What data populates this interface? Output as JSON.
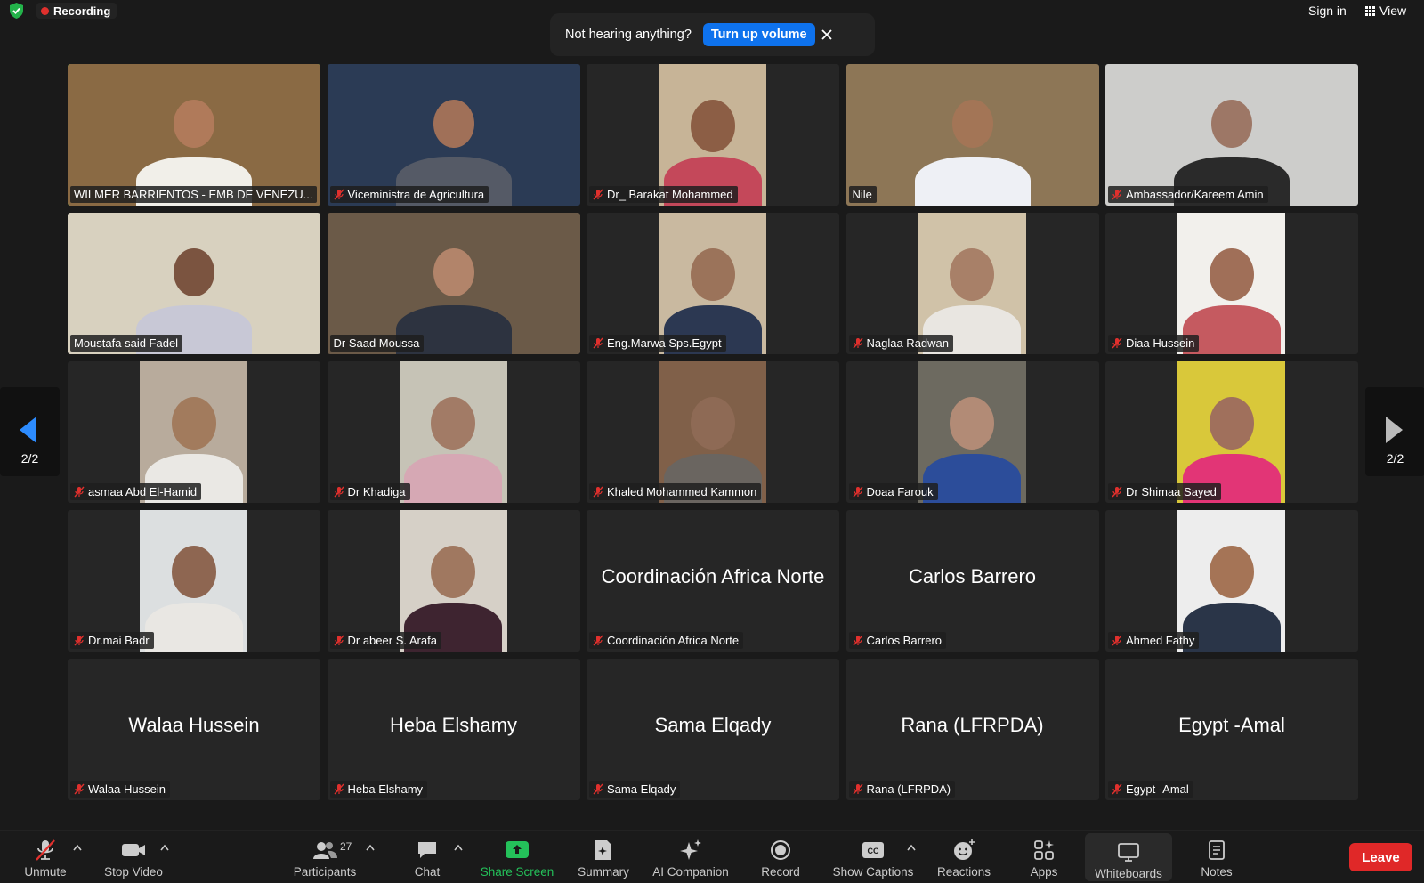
{
  "top": {
    "recording": "Recording",
    "sign_in": "Sign in",
    "view": "View",
    "notice_text": "Not hearing anything?",
    "notice_button": "Turn up volume"
  },
  "page_indicator_left": "2/2",
  "page_indicator_right": "2/2",
  "participants_grid": [
    {
      "name": "WILMER BARRIENTOS - EMB DE VENEZU...",
      "muted": false,
      "video": "full",
      "bg": "#8a6a44",
      "skin": "#b07a5a",
      "shirt": "#f1efe9",
      "active": true
    },
    {
      "name": "Viceministra de Agricultura",
      "muted": true,
      "video": "full",
      "bg": "#2b3b55",
      "skin": "#a07058",
      "shirt": "#555a66"
    },
    {
      "name": "Dr_ Barakat Mohammed",
      "muted": true,
      "video": "narrow",
      "bg": "#c7b497",
      "skin": "#8c5e45",
      "shirt": "#c4485a"
    },
    {
      "name": "Nile",
      "muted": false,
      "video": "full",
      "bg": "#8d7656",
      "skin": "#a37556",
      "shirt": "#eef0f5"
    },
    {
      "name": "Ambassador/Kareem Amin",
      "muted": true,
      "video": "full",
      "bg": "#cdcdcb",
      "skin": "#9d7766",
      "shirt": "#2a2a2a"
    },
    {
      "name": "Moustafa said Fadel",
      "muted": false,
      "video": "full",
      "bg": "#d8d1bf",
      "skin": "#7b5440",
      "shirt": "#c8c8d6"
    },
    {
      "name": "Dr Saad Moussa",
      "muted": false,
      "video": "full",
      "bg": "#6b5a48",
      "skin": "#b2846a",
      "shirt": "#2d3340"
    },
    {
      "name": "Eng.Marwa Sps.Egypt",
      "muted": true,
      "video": "narrow",
      "bg": "#c9b9a0",
      "skin": "#9b735a",
      "shirt": "#2c3852"
    },
    {
      "name": "Naglaa Radwan",
      "muted": true,
      "video": "narrow",
      "bg": "#d0c2a8",
      "skin": "#a88068",
      "shirt": "#e9e6e1"
    },
    {
      "name": "Diaa Hussein",
      "muted": true,
      "video": "narrow",
      "bg": "#f2f0ec",
      "skin": "#a06f58",
      "shirt": "#c55a60"
    },
    {
      "name": "asmaa Abd El-Hamid",
      "muted": true,
      "video": "narrow",
      "bg": "#b8ab9c",
      "skin": "#a27b5d",
      "shirt": "#eae8e4"
    },
    {
      "name": "Dr Khadiga",
      "muted": true,
      "video": "narrow",
      "bg": "#c6c3b6",
      "skin": "#a27b66",
      "shirt": "#d6a8b4"
    },
    {
      "name": "Khaled Mohammed Kammon",
      "muted": true,
      "video": "narrow",
      "bg": "#806049",
      "skin": "#8e6a55",
      "shirt": "#6a6560"
    },
    {
      "name": "Doaa Farouk",
      "muted": true,
      "video": "narrow",
      "bg": "#6d6a60",
      "skin": "#b28b76",
      "shirt": "#2c4d9a"
    },
    {
      "name": "Dr Shimaa Sayed",
      "muted": true,
      "video": "narrow",
      "bg": "#d9c83a",
      "skin": "#a0705c",
      "shirt": "#e23576"
    },
    {
      "name": "Dr.mai Badr",
      "muted": true,
      "video": "narrow",
      "bg": "#dcdfe0",
      "skin": "#8e6651",
      "shirt": "#e9e7e3"
    },
    {
      "name": "Dr abeer S. Arafa",
      "muted": true,
      "video": "narrow",
      "bg": "#d6d0c7",
      "skin": "#a07860",
      "shirt": "#3e2430"
    },
    {
      "name": "Coordinación Africa Norte",
      "muted": true,
      "video": "none"
    },
    {
      "name": "Carlos Barrero",
      "muted": true,
      "video": "none"
    },
    {
      "name": "Ahmed Fathy",
      "muted": true,
      "video": "narrow",
      "bg": "#ededed",
      "skin": "#a57456",
      "shirt": "#2a3548"
    },
    {
      "name": "Walaa Hussein",
      "muted": true,
      "video": "none"
    },
    {
      "name": "Heba Elshamy",
      "muted": true,
      "video": "none"
    },
    {
      "name": "Sama Elqady",
      "muted": true,
      "video": "none"
    },
    {
      "name": "Rana (LFRPDA)",
      "muted": true,
      "video": "none"
    },
    {
      "name": "Egypt -Amal",
      "muted": true,
      "video": "none"
    }
  ],
  "toolbar": {
    "unmute": "Unmute",
    "stop_video": "Stop Video",
    "participants": "Participants",
    "participants_count": "27",
    "chat": "Chat",
    "share_screen": "Share Screen",
    "summary": "Summary",
    "ai_companion": "AI Companion",
    "record": "Record",
    "show_captions": "Show Captions",
    "reactions": "Reactions",
    "apps": "Apps",
    "whiteboards": "Whiteboards",
    "notes": "Notes",
    "leave": "Leave"
  },
  "colors": {
    "accent_blue": "#0e72ed",
    "active_speaker": "#2fd05a",
    "share_green": "#24c15a",
    "leave_red": "#e02828",
    "mute_red": "#e0302d"
  }
}
